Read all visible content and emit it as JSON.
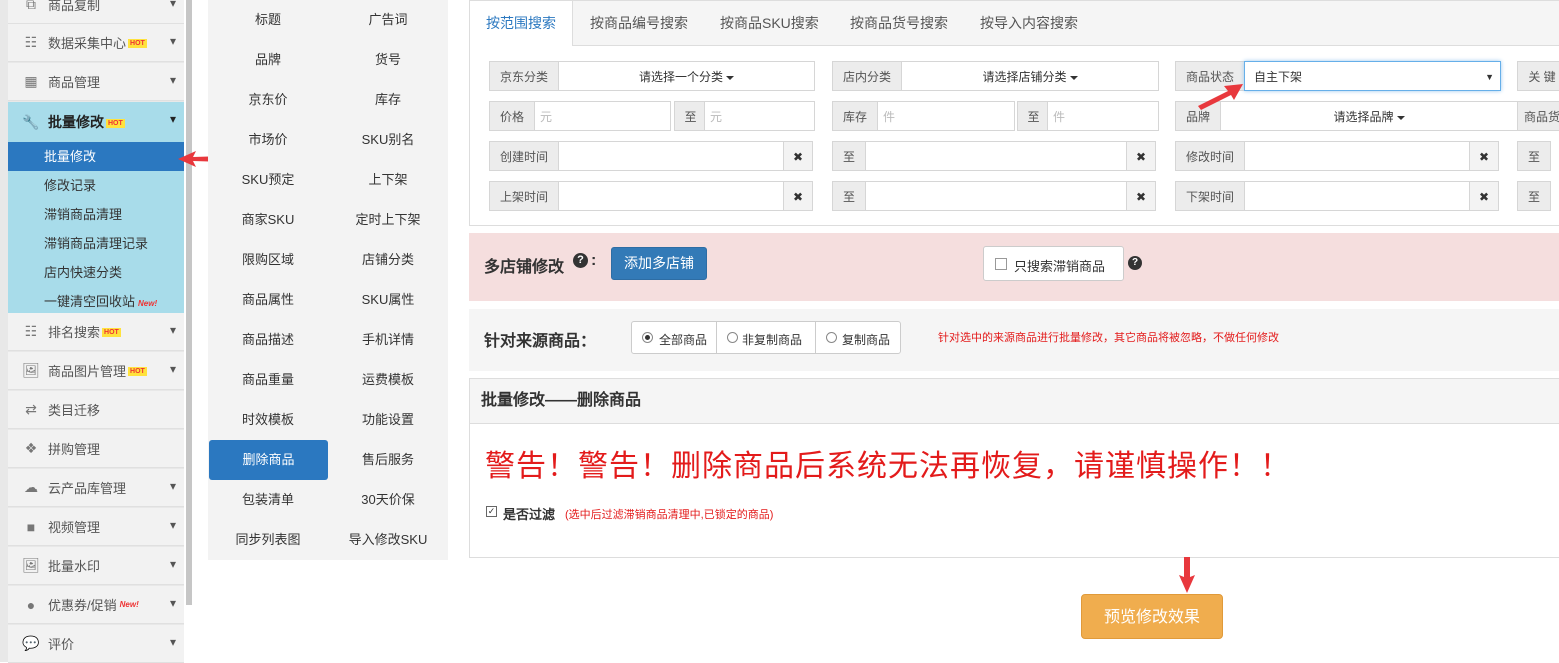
{
  "sidebar": {
    "items_top": [
      {
        "label": "商品复制",
        "icon": "copy-icon"
      },
      {
        "label": "数据采集中心",
        "icon": "list-icon",
        "hot": "HOT"
      },
      {
        "label": "商品管理",
        "icon": "grid-icon"
      }
    ],
    "active": {
      "label": "批量修改",
      "hot": "HOT",
      "icon": "wrench-icon",
      "subs": [
        "批量修改",
        "修改记录",
        "滞销商品清理",
        "滞销商品清理记录",
        "店内快速分类",
        "一键清空回收站"
      ],
      "new_badge": "New!"
    },
    "items_bottom": [
      {
        "label": "排名搜索",
        "icon": "list-icon",
        "hot": "HOT"
      },
      {
        "label": "商品图片管理",
        "icon": "image-icon",
        "hot": "HOT"
      },
      {
        "label": "类目迁移",
        "icon": "transfer-icon"
      },
      {
        "label": "拼购管理",
        "icon": "cubes-icon"
      },
      {
        "label": "云产品库管理",
        "icon": "cloud-icon"
      },
      {
        "label": "视频管理",
        "icon": "video-icon"
      },
      {
        "label": "批量水印",
        "icon": "image-icon"
      },
      {
        "label": "优惠券/促销",
        "icon": "github-icon",
        "new": "New!"
      },
      {
        "label": "评价",
        "icon": "comment-icon"
      }
    ]
  },
  "fields": [
    [
      "标题",
      "广告词"
    ],
    [
      "品牌",
      "货号"
    ],
    [
      "京东价",
      "库存"
    ],
    [
      "市场价",
      "SKU别名"
    ],
    [
      "SKU预定",
      "上下架"
    ],
    [
      "商家SKU",
      "定时上下架"
    ],
    [
      "限购区域",
      "店铺分类"
    ],
    [
      "商品属性",
      "SKU属性"
    ],
    [
      "商品描述",
      "手机详情"
    ],
    [
      "商品重量",
      "运费模板"
    ],
    [
      "时效模板",
      "功能设置"
    ],
    [
      "删除商品",
      "售后服务"
    ],
    [
      "包装清单",
      "30天价保"
    ],
    [
      "同步列表图",
      "导入修改SKU"
    ]
  ],
  "search": {
    "tabs": [
      "按范围搜索",
      "按商品编号搜索",
      "按商品SKU搜索",
      "按商品货号搜索",
      "按导入内容搜索"
    ],
    "jd_category_label": "京东分类",
    "jd_category_value": "请选择一个分类",
    "shop_category_label": "店内分类",
    "shop_category_value": "请选择店铺分类",
    "status_label": "商品状态",
    "status_value": "自主下架",
    "keyword_label": "关 键",
    "price_label": "价格",
    "price_unit": "元",
    "to": "至",
    "stock_label": "库存",
    "stock_unit": "件",
    "brand_label": "品牌",
    "brand_value": "请选择品牌",
    "goods_no_label": "商品货",
    "created_label": "创建时间",
    "modified_label": "修改时间",
    "listed_label": "上架时间",
    "delisted_label": "下架时间",
    "clear": "✖"
  },
  "multi": {
    "label": "多店铺修改",
    "add_button": "添加多店铺",
    "only_unsold": "只搜索滞销商品"
  },
  "source": {
    "label": "针对来源商品：",
    "options": [
      "全部商品",
      "非复制商品",
      "复制商品"
    ],
    "note": "针对选中的来源商品进行批量修改，其它商品将被忽略，不做任何修改"
  },
  "section": {
    "title": "批量修改——删除商品",
    "warning": "警告！警告！删除商品后系统无法再恢复，请谨慎操作！！",
    "filter_label": "是否过滤",
    "filter_note": "(选中后过滤滞销商品清理中,已锁定的商品)"
  },
  "preview_button": "预览修改效果",
  "colors": {
    "primary": "#2b78c0",
    "warning_text": "#e31b1b",
    "preview": "#f0ad4e",
    "active_sidebar": "#a8dcea",
    "arrow": "#e8383d"
  }
}
